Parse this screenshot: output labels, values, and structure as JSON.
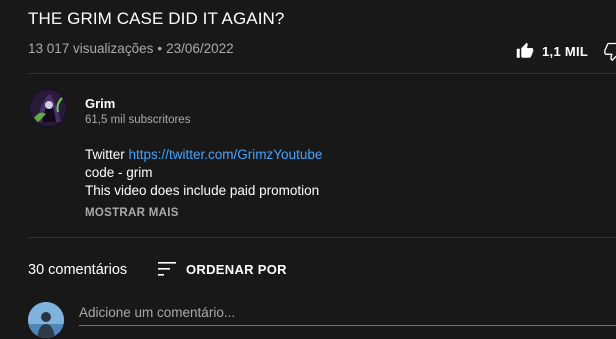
{
  "video": {
    "title": "THE GRIM CASE DID IT AGAIN?",
    "views": "13 017 visualizações",
    "separator": "•",
    "date": "23/06/2022",
    "like_count": "1,1 MIL",
    "like_icon": "thumb-up-icon",
    "dislike_icon": "thumb-down-icon"
  },
  "channel": {
    "name": "Grim",
    "subscribers": "61,5 mil subscritores"
  },
  "description": {
    "line1_prefix": "Twitter ",
    "line1_link": "https://twitter.com/GrimzYoutube",
    "line2": "code - grim",
    "line3": "This video does include paid promotion",
    "show_more": "MOSTRAR MAIS"
  },
  "comments": {
    "count_label": "30 comentários",
    "sort_label": "ORDENAR POR",
    "sort_icon": "sort-icon",
    "placeholder": "Adicione um comentário..."
  },
  "colors": {
    "background": "#181818",
    "text": "#ffffff",
    "secondary": "#aaaaaa",
    "link": "#3ea6ff",
    "divider": "#303030"
  }
}
